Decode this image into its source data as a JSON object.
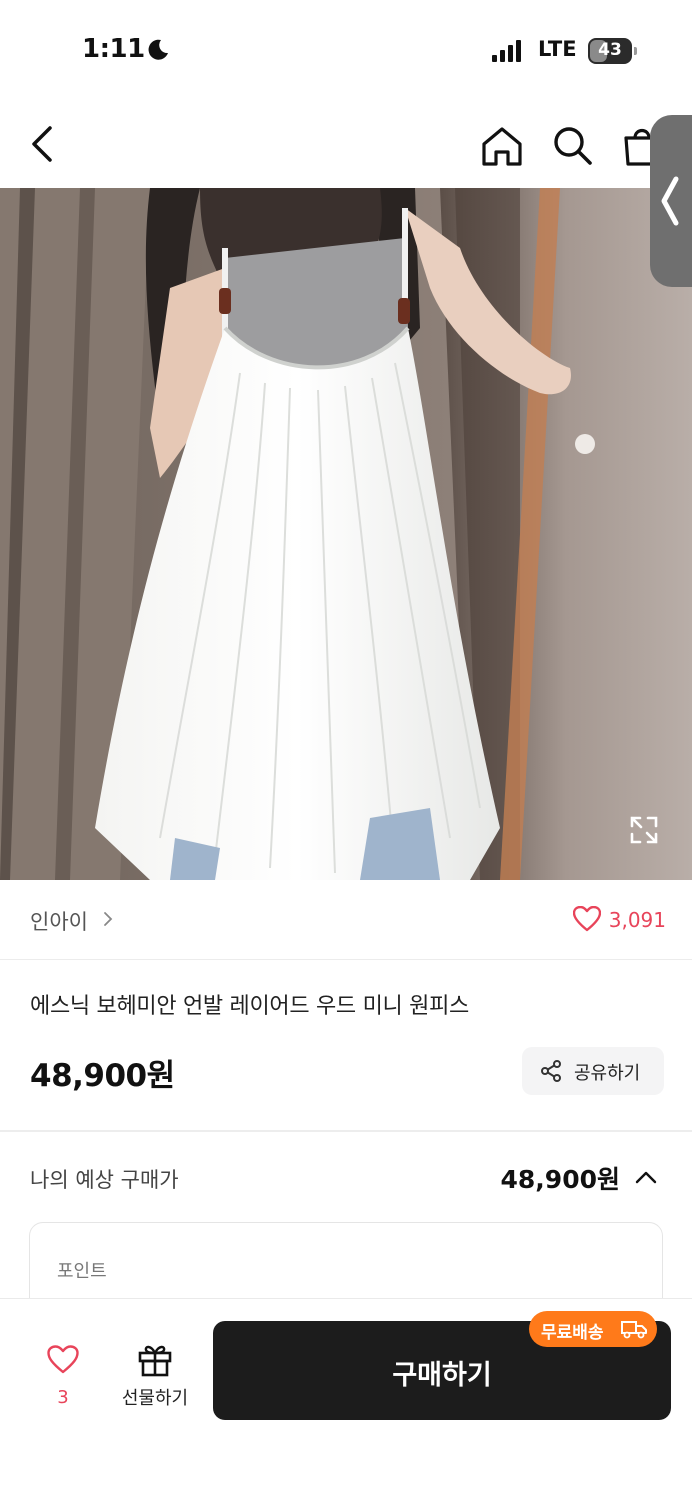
{
  "status_bar": {
    "time": "1:11",
    "network": "LTE",
    "battery": "43",
    "battery_level": 0.43
  },
  "nav": {
    "icons": [
      "back-icon",
      "home-icon",
      "search-icon",
      "cart-icon",
      "chevron-left-icon"
    ]
  },
  "product": {
    "brand": "인아이",
    "likes": "3,091",
    "title": "에스닉 보헤미안 언발 레이어드 우드 미니 원피스",
    "price": "48,900원",
    "share_label": "공유하기"
  },
  "estimate": {
    "label": "나의 예상 구매가",
    "price": "48,900원"
  },
  "points": {
    "label": "포인트"
  },
  "bottom_bar": {
    "wish_count": "3",
    "gift_label": "선물하기",
    "buy_label": "구매하기",
    "shipping_badge": "무료배송"
  },
  "colors": {
    "accent": "#e8445a",
    "badge": "#ff7a1a",
    "buy_button": "#1c1c1c"
  }
}
